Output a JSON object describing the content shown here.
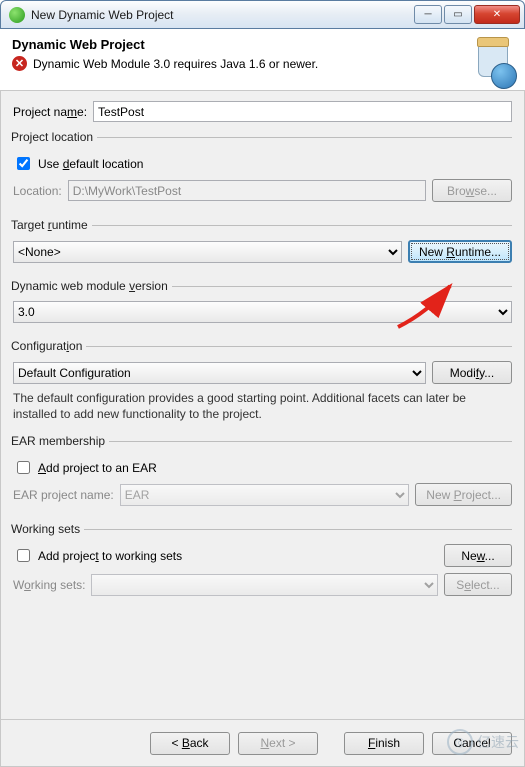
{
  "window": {
    "title": "New Dynamic Web Project"
  },
  "banner": {
    "heading": "Dynamic Web Project",
    "error": "Dynamic Web Module 3.0 requires Java 1.6 or newer."
  },
  "projectName": {
    "label": "Project name:",
    "value": "TestPost"
  },
  "projectLocation": {
    "legend": "Project location",
    "useDefault": "Use default location",
    "useDefaultChecked": true,
    "locationLabel": "Location:",
    "locationValue": "D:\\MyWork\\TestPost",
    "browse": "Browse..."
  },
  "targetRuntime": {
    "legend": "Target runtime",
    "selected": "<None>",
    "newRuntime": "New Runtime..."
  },
  "webModuleVersion": {
    "legend": "Dynamic web module version",
    "selected": "3.0"
  },
  "configuration": {
    "legend": "Configuration",
    "selected": "Default Configuration",
    "modify": "Modify...",
    "description": "The default configuration provides a good starting point. Additional facets can later be installed to add new functionality to the project."
  },
  "ear": {
    "legend": "EAR membership",
    "addToEar": "Add project to an EAR",
    "addChecked": false,
    "projectNameLabel": "EAR project name:",
    "projectNameValue": "EAR",
    "newProject": "New Project..."
  },
  "workingSets": {
    "legend": "Working sets",
    "addToWs": "Add project to working sets",
    "addChecked": false,
    "new": "New...",
    "wsLabel": "Working sets:",
    "select": "Select..."
  },
  "footer": {
    "back": "< Back",
    "next": "Next >",
    "finish": "Finish",
    "cancel": "Cancel"
  },
  "watermark": "亿速云"
}
